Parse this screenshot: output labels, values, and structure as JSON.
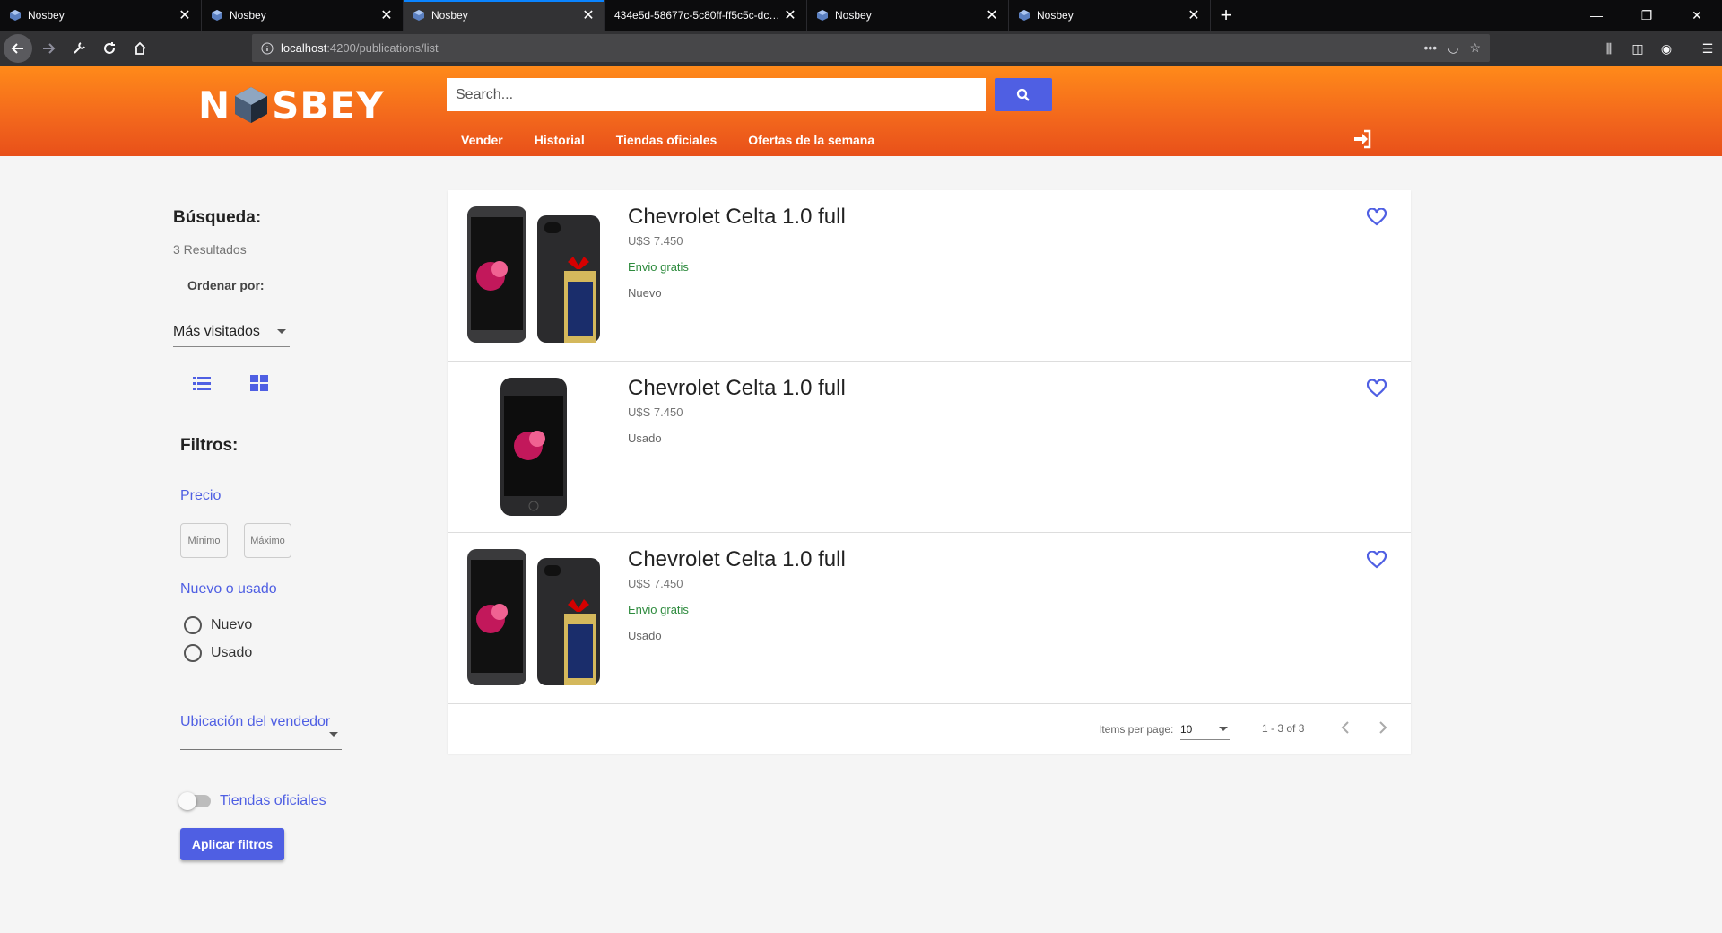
{
  "browser": {
    "tabs": [
      {
        "label": "Nosbey",
        "active": false
      },
      {
        "label": "Nosbey",
        "active": false
      },
      {
        "label": "Nosbey",
        "active": true
      },
      {
        "label": "434e5d-58677c-5c80ff-ff5c5c-dce0e6",
        "active": false
      },
      {
        "label": "Nosbey",
        "active": false
      },
      {
        "label": "Nosbey",
        "active": false
      }
    ],
    "url_host": "localhost",
    "url_path": ":4200/publications/list"
  },
  "header": {
    "logo_left": "N",
    "logo_right": "SBEY",
    "search_placeholder": "Search...",
    "nav": [
      "Vender",
      "Historial",
      "Tiendas oficiales",
      "Ofertas de la semana"
    ]
  },
  "sidebar": {
    "title": "Búsqueda:",
    "count": "3 Resultados",
    "order_label": "Ordenar por:",
    "order_value": "Más visitados",
    "filters_title": "Filtros:",
    "price_label": "Precio",
    "price_min": "Mínimo",
    "price_max": "Máximo",
    "condition_label": "Nuevo o usado",
    "condition_options": [
      "Nuevo",
      "Usado"
    ],
    "location_label": "Ubicación del vendedor",
    "official_stores_label": "Tiendas oficiales",
    "apply_label": "Aplicar filtros"
  },
  "results": [
    {
      "title": "Chevrolet Celta 1.0 full",
      "price": "U$S 7.450",
      "shipping": "Envio gratis",
      "condition": "Nuevo",
      "image": "iphone-pair-gift"
    },
    {
      "title": "Chevrolet Celta 1.0 full",
      "price": "U$S 7.450",
      "shipping": "",
      "condition": "Usado",
      "image": "iphone-single"
    },
    {
      "title": "Chevrolet Celta 1.0 full",
      "price": "U$S 7.450",
      "shipping": "Envio gratis",
      "condition": "Usado",
      "image": "iphone-pair-gift"
    }
  ],
  "pager": {
    "items_per_page_label": "Items per page:",
    "items_per_page": "10",
    "range": "1 - 3 of 3"
  },
  "colors": {
    "accent": "#4f5fe3",
    "header_orange": "#f2661c",
    "shipping_green": "#2e8b3e"
  }
}
